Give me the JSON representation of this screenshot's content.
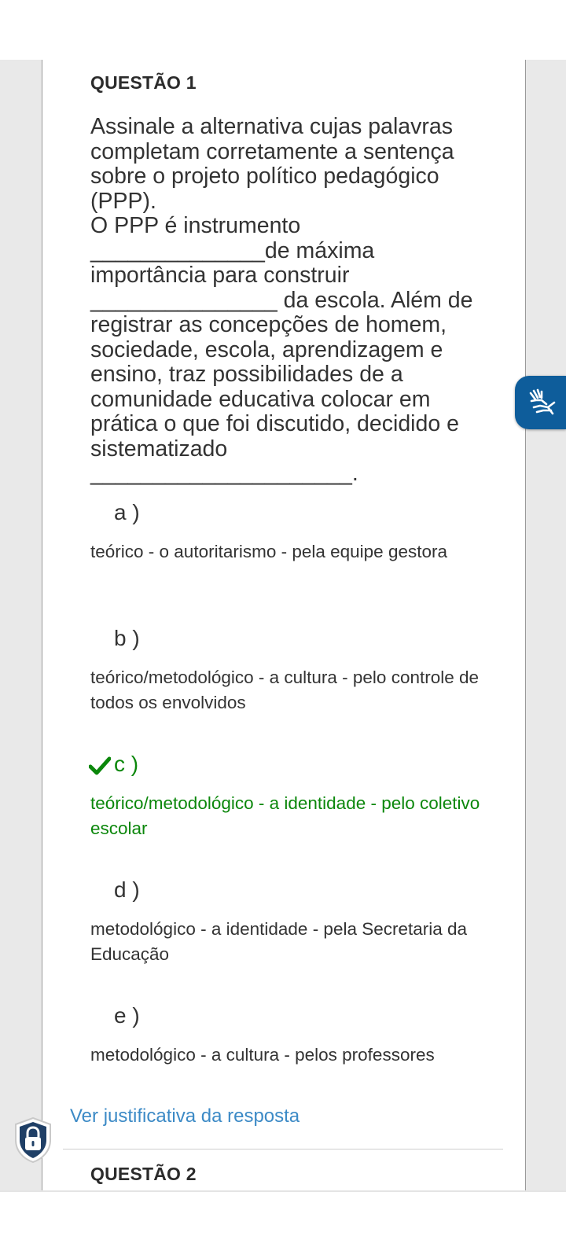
{
  "question1": {
    "title": "QUESTÃO 1",
    "statement_lines": [
      "Assinale a alternativa cujas palavras",
      "completam corretamente a sentença",
      "sobre o projeto político pedagógico",
      "(PPP).",
      "O PPP é instrumento",
      "______________de máxima",
      "importância para construir",
      "_______________ da escola. Além de",
      "registrar as concepções de homem,",
      "sociedade, escola, aprendizagem e",
      "ensino, traz possibilidades de a",
      "comunidade educativa colocar em",
      "prática o que foi discutido, decidido e",
      "sistematizado",
      "_____________________."
    ],
    "alternatives": [
      {
        "letter": "a )",
        "text": "teórico - o autoritarismo - pela equipe gestora",
        "correct": false
      },
      {
        "letter": "b )",
        "text": "teórico/metodológico - a cultura - pelo controle de todos os envolvidos",
        "correct": false
      },
      {
        "letter": "c )",
        "text": "teórico/metodológico - a identidade - pelo coletivo escolar",
        "correct": true
      },
      {
        "letter": "d )",
        "text": "metodológico - a identidade - pela Secretaria da Educação",
        "correct": false
      },
      {
        "letter": "e )",
        "text": "metodológico - a cultura - pelos professores",
        "correct": false
      }
    ],
    "justification_link": "Ver justificativa da resposta"
  },
  "question2": {
    "title": "QUESTÃO 2"
  },
  "icons": {
    "correct": "check-icon",
    "accessibility": "sign-language-hands-icon",
    "privacy": "lock-shield-icon"
  },
  "colors": {
    "correct": "#0b870b",
    "link": "#3c8ac6",
    "accessibility_button": "#0e5d9b",
    "gutter": "#e9e9e9"
  }
}
